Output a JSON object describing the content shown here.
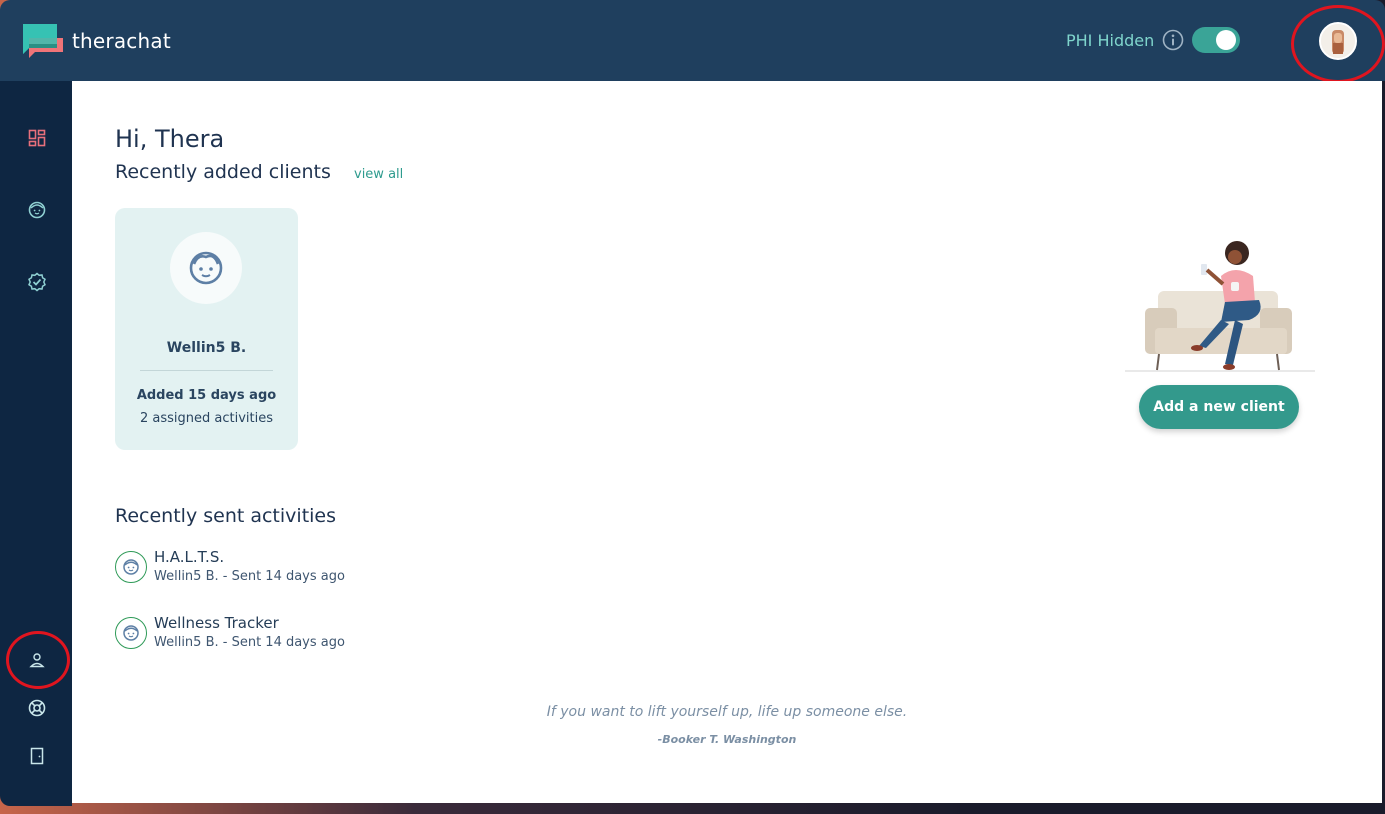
{
  "app": {
    "name": "therachat"
  },
  "header": {
    "phi_label": "PHI Hidden",
    "phi_toggle_on": true
  },
  "sidebar": {
    "items": [
      {
        "icon": "dashboard-icon"
      },
      {
        "icon": "clients-face-icon"
      },
      {
        "icon": "badge-check-icon"
      },
      {
        "icon": "user-profile-icon"
      },
      {
        "icon": "lifebuoy-icon"
      },
      {
        "icon": "logout-door-icon"
      }
    ]
  },
  "main": {
    "greeting": "Hi, Thera",
    "recent_clients_heading": "Recently added clients",
    "view_all_label": "view all",
    "clients": [
      {
        "name": "Wellin5 B.",
        "added": "Added 15 days ago",
        "activities": "2 assigned activities"
      }
    ],
    "add_client_label": "Add a new client",
    "recent_activities_heading": "Recently sent activities",
    "activities": [
      {
        "title": "H.A.L.T.S.",
        "subtitle": "Wellin5 B. - Sent 14 days ago"
      },
      {
        "title": "Wellness Tracker",
        "subtitle": "Wellin5 B. - Sent 14 days ago"
      }
    ],
    "quote": "If you want to lift yourself up, life up someone else.",
    "quote_author": "-Booker T. Washington"
  },
  "colors": {
    "header_bg": "#1f3f5e",
    "sidebar_bg": "#0e2642",
    "accent": "#33998c",
    "highlight_ring": "#e0151f"
  }
}
